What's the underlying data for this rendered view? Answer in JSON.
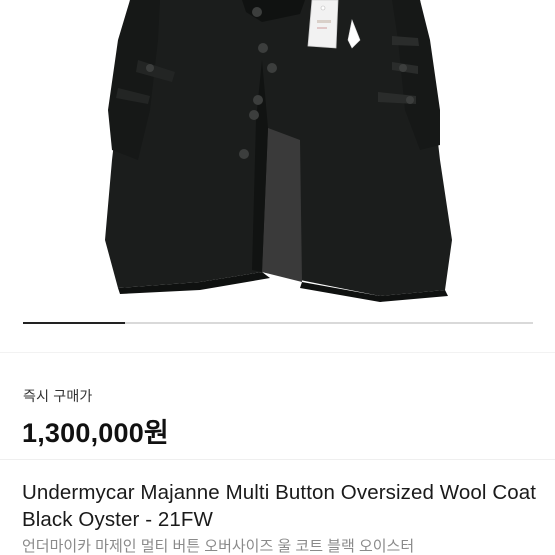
{
  "product": {
    "image_alt": "black wool coat product photo",
    "image_count": 1,
    "active_index": 1,
    "indicator_progress": 0.2
  },
  "purchase": {
    "label": "즉시 구매가",
    "price": "1,300,000원"
  },
  "title": {
    "en": "Undermycar Majanne Multi Button Oversized Wool Coat Black Oyster - 21FW",
    "ko": "언더마이카 마제인 멀티 버튼 오버사이즈 울 코트 블랙 오이스터"
  },
  "colors": {
    "coat": "#1b1d1c",
    "lining": "#3a3a3a",
    "indicator_active": "#222222",
    "indicator_track": "#d9d9d9",
    "subtitle": "#8a8a8a"
  },
  "icons": {
    "buttons": "coat-button-icon",
    "tag": "hang-tag-icon"
  }
}
